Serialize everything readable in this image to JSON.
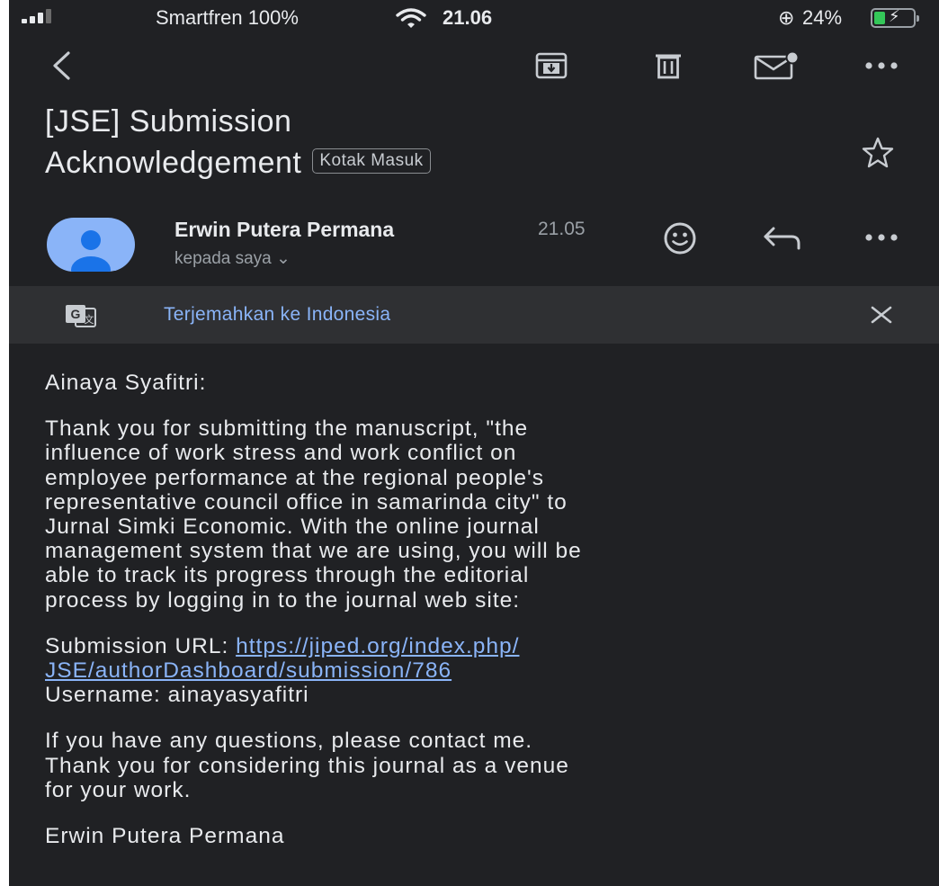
{
  "status_bar": {
    "carrier": "Smartfren 100%",
    "time": "21.06",
    "battery": "24%"
  },
  "toolbar": {
    "back_icon": "back-arrow-icon",
    "archive_icon": "archive-icon",
    "delete_icon": "trash-icon",
    "unread_icon": "mark-unread-icon",
    "more_icon": "more-horizontal-icon"
  },
  "email": {
    "subject_line1": "[JSE] Submission",
    "subject_line2": "Acknowledgement",
    "label": "Kotak Masuk",
    "sender": "Erwin Putera Permana",
    "time": "21.05",
    "recipient": "kepada saya ⌄"
  },
  "translate": {
    "link": "Terjemahkan ke Indonesia"
  },
  "body": {
    "greeting": "Ainaya Syafitri:",
    "paragraph1": [
      "Thank you for submitting the manuscript, \"the",
      "influence of work stress and work conflict on",
      "employee performance at the regional people's",
      "representative council office in samarinda city\" to",
      "Jurnal Simki Economic. With the online journal",
      "management system that we are using, you will be",
      "able to track its progress through the editorial",
      "process by logging in to the journal web site:"
    ],
    "url_label": "Submission URL: ",
    "url_line1": "https://jiped.org/index.php/",
    "url_line2": "JSE/authorDashboard/submission/786",
    "username": "Username: ainayasyafitri",
    "paragraph2": [
      "If you have any questions, please contact me.",
      "Thank you for considering this journal as a venue",
      "for your work."
    ],
    "signature": "Erwin Putera Permana"
  },
  "colors": {
    "background": "#202124",
    "link": "#8ab4f8",
    "avatar": "#8ab4f8",
    "battery": "#34c759"
  }
}
